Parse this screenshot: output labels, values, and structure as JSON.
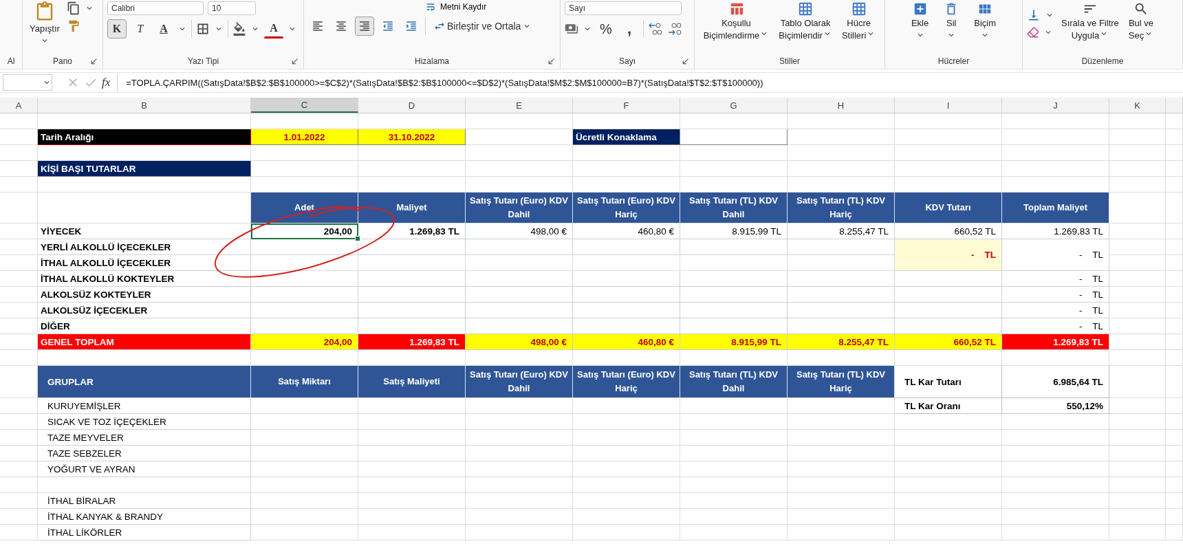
{
  "ribbon": {
    "cut_group_label": "Al",
    "clipboard": {
      "label": "Pano",
      "paste": "Yapıştır"
    },
    "font": {
      "label": "Yazı Tipi",
      "font_name": "Calibri",
      "font_size": "10",
      "bold_label": "K",
      "bold_pressed": true,
      "italic_label": "T",
      "underline_label": "A",
      "font_color_label": "A"
    },
    "alignment": {
      "label": "Hizalama",
      "wrap_text": "Metni Kaydır",
      "merge": "Birleştir ve Ortala",
      "align": [
        {
          "kind": "left",
          "selected": false
        },
        {
          "kind": "center",
          "selected": false
        },
        {
          "kind": "right",
          "selected": true
        }
      ]
    },
    "number": {
      "label": "Sayı",
      "format": "Sayı",
      "percent": "%",
      "comma": ","
    },
    "styles": {
      "label": "Stiller",
      "buttons": [
        {
          "lines": [
            "Koşullu",
            "Biçimlendirme"
          ]
        },
        {
          "lines": [
            "Tablo Olarak",
            "Biçimlendir"
          ]
        },
        {
          "lines": [
            "Hücre",
            "Stilleri"
          ]
        }
      ]
    },
    "cells": {
      "label": "Hücreler",
      "buttons": [
        "Ekle",
        "Sil",
        "Biçim"
      ]
    },
    "editing": {
      "label": "Düzenleme",
      "buttons": [
        {
          "lines": [
            "Sırala ve Filtre",
            "Uygula"
          ]
        },
        {
          "lines": [
            "Bul ve",
            "Seç"
          ]
        }
      ]
    }
  },
  "formula_bar": {
    "fx": "fx",
    "formula": "=TOPLA.ÇARPIM((SatışData!$B$2:$B$100000>=$C$2)*(SatışData!$B$2:$B$100000<=$D$2)*(SatışData!$M$2:$M$100000=B7)*(SatışData!$T$2:$T$100000))"
  },
  "columns": [
    {
      "letter": "A",
      "selected": false
    },
    {
      "letter": "B",
      "selected": false
    },
    {
      "letter": "C",
      "selected": true
    },
    {
      "letter": "D",
      "selected": false
    },
    {
      "letter": "E",
      "selected": false
    },
    {
      "letter": "F",
      "selected": false
    },
    {
      "letter": "G",
      "selected": false
    },
    {
      "letter": "H",
      "selected": false
    },
    {
      "letter": "I",
      "selected": false
    },
    {
      "letter": "J",
      "selected": false
    },
    {
      "letter": "K",
      "selected": false
    }
  ],
  "sheet": {
    "date_range": {
      "label": "Tarih Aralığı",
      "start": "1.01.2022",
      "end": "31.10.2022"
    },
    "paid_accommodation": {
      "label": "Ücretli Konaklama"
    },
    "per_person_title": "KİŞİ BAŞI TUTARLAR",
    "summary": {
      "columns": [
        "Adet",
        "Maliyet",
        "Satış Tutarı (Euro) KDV Dahil",
        "Satış Tutarı (Euro) KDV Hariç",
        "Satış Tutarı (TL) KDV Dahil",
        "Satış Tutarı (TL) KDV Hariç",
        "KDV Tutarı",
        "Toplam Maliyet"
      ],
      "rows": [
        {
          "label": "YİYECEK",
          "cells": [
            {
              "value": "204,00",
              "selected": true,
              "highlight": false,
              "merged": false
            },
            {
              "value": "1.269,83 TL",
              "selected": false,
              "highlight": false,
              "merged": false
            },
            {
              "value": "498,00 €",
              "selected": false,
              "highlight": false,
              "merged": false
            },
            {
              "value": "460,80 €",
              "selected": false,
              "highlight": false,
              "merged": false
            },
            {
              "value": "8.915,99 TL",
              "selected": false,
              "highlight": false,
              "merged": false
            },
            {
              "value": "8.255,47 TL",
              "selected": false,
              "highlight": false,
              "merged": false
            },
            {
              "value": "660,52 TL",
              "selected": false,
              "highlight": false,
              "merged": false
            },
            {
              "value": "1.269,83 TL",
              "selected": false,
              "highlight": false,
              "merged": false
            }
          ]
        },
        {
          "label": "YERLİ ALKOLLÜ İÇECEKLER",
          "cells": [
            {
              "selected": false,
              "highlight": false,
              "merged": false
            },
            {
              "selected": false,
              "highlight": false,
              "merged": false
            },
            {
              "selected": false,
              "highlight": false,
              "merged": false
            },
            {
              "selected": false,
              "highlight": false,
              "merged": false
            },
            {
              "selected": false,
              "highlight": false,
              "merged": false
            },
            {
              "selected": false,
              "highlight": false,
              "merged": false
            },
            {
              "value": "-    TL",
              "selected": false,
              "highlight": true,
              "merged": true
            },
            {
              "value": "-    TL",
              "selected": false,
              "highlight": false,
              "merged": true
            }
          ]
        },
        {
          "label": "İTHAL ALKOLLÜ İÇECEKLER",
          "cells": []
        },
        {
          "label": "İTHAL ALKOLLÜ KOKTEYLER",
          "cells": [
            {
              "selected": false,
              "highlight": false,
              "merged": false
            },
            {
              "selected": false,
              "highlight": false,
              "merged": false
            },
            {
              "selected": false,
              "highlight": false,
              "merged": false
            },
            {
              "selected": false,
              "highlight": false,
              "merged": false
            },
            {
              "selected": false,
              "highlight": false,
              "merged": false
            },
            {
              "selected": false,
              "highlight": false,
              "merged": false
            },
            {
              "selected": false,
              "highlight": false,
              "merged": false
            },
            {
              "value": "-    TL",
              "selected": false,
              "highlight": false,
              "merged": false
            }
          ]
        },
        {
          "label": "ALKOLSÜZ KOKTEYLER",
          "cells": [
            {
              "selected": false,
              "highlight": false,
              "merged": false
            },
            {
              "selected": false,
              "highlight": false,
              "merged": false
            },
            {
              "selected": false,
              "highlight": false,
              "merged": false
            },
            {
              "selected": false,
              "highlight": false,
              "merged": false
            },
            {
              "selected": false,
              "highlight": false,
              "merged": false
            },
            {
              "selected": false,
              "highlight": false,
              "merged": false
            },
            {
              "selected": false,
              "highlight": false,
              "merged": false
            },
            {
              "value": "-    TL",
              "selected": false,
              "highlight": false,
              "merged": false
            }
          ]
        },
        {
          "label": "ALKOLSÜZ İÇECEKLER",
          "cells": [
            {
              "selected": false,
              "highlight": false,
              "merged": false
            },
            {
              "selected": false,
              "highlight": false,
              "merged": false
            },
            {
              "selected": false,
              "highlight": false,
              "merged": false
            },
            {
              "selected": false,
              "highlight": false,
              "merged": false
            },
            {
              "selected": false,
              "highlight": false,
              "merged": false
            },
            {
              "selected": false,
              "highlight": false,
              "merged": false
            },
            {
              "selected": false,
              "highlight": false,
              "merged": false
            },
            {
              "value": "-    TL",
              "selected": false,
              "highlight": false,
              "merged": false
            }
          ]
        },
        {
          "label": "DİĞER",
          "cells": [
            {
              "selected": false,
              "highlight": false,
              "merged": false
            },
            {
              "selected": false,
              "highlight": false,
              "merged": false
            },
            {
              "selected": false,
              "highlight": false,
              "merged": false
            },
            {
              "selected": false,
              "highlight": false,
              "merged": false
            },
            {
              "selected": false,
              "highlight": false,
              "merged": false
            },
            {
              "selected": false,
              "highlight": false,
              "merged": false
            },
            {
              "selected": false,
              "highlight": false,
              "merged": false
            },
            {
              "value": "-    TL",
              "selected": false,
              "highlight": false,
              "merged": false
            }
          ]
        }
      ],
      "total": {
        "label": "GENEL TOPLAM",
        "cells": [
          {
            "value": "204,00",
            "kind": "yellow"
          },
          {
            "value": "1.269,83 TL",
            "kind": "red"
          },
          {
            "value": "498,00 €",
            "kind": "yellow"
          },
          {
            "value": "460,80 €",
            "kind": "yellow"
          },
          {
            "value": "8.915,99 TL",
            "kind": "yellow"
          },
          {
            "value": "8.255,47 TL",
            "kind": "yellow"
          },
          {
            "value": "660,52 TL",
            "kind": "yellow"
          },
          {
            "value": "1.269,83 TL",
            "kind": "red"
          }
        ]
      }
    },
    "groups": {
      "title": "GRUPLAR",
      "columns": [
        "Satış Miktarı",
        "Satış Maliyeti",
        "Satış Tutarı (Euro) KDV Dahil",
        "Satış Tutarı (Euro) KDV Hariç",
        "Satış Tutarı (TL) KDV Dahil",
        "Satış Tutarı (TL) KDV Hariç"
      ],
      "sections": [
        [
          "KURUYEMİŞLER",
          "SICAK VE TOZ İÇEÇEKLER",
          "TAZE MEYVELER",
          "TAZE SEBZELER",
          "YOĞURT VE AYRAN"
        ],
        [
          "İTHAL BİRALAR",
          "İTHAL KANYAK & BRANDY",
          "İTHAL LİKÖRLER"
        ]
      ]
    },
    "profit": [
      {
        "label": "TL Kar Tutarı",
        "value": "6.985,64 TL"
      },
      {
        "label": "TL Kar Oranı",
        "value": "550,12%"
      }
    ]
  }
}
